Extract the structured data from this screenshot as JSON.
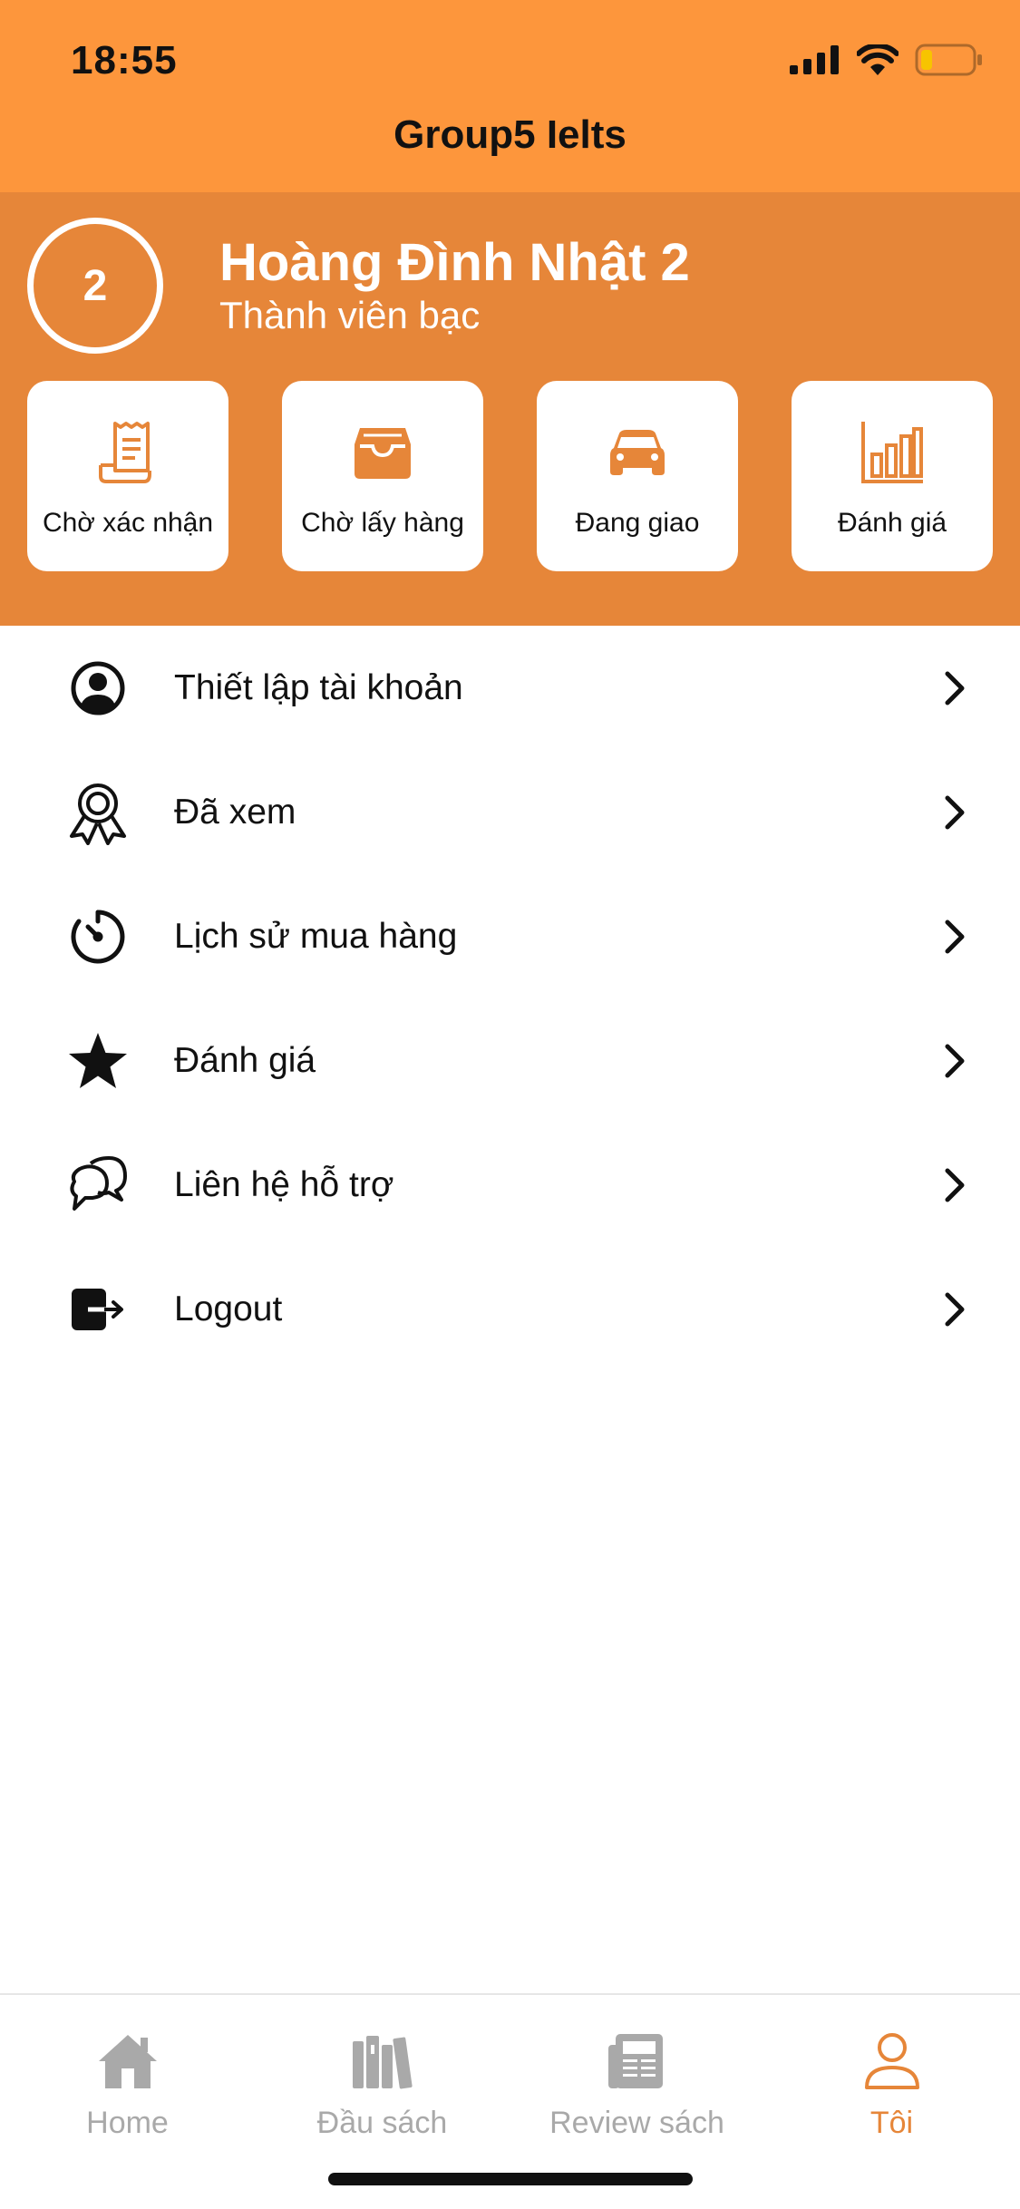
{
  "status_bar": {
    "time": "18:55"
  },
  "header": {
    "title": "Group5 Ielts"
  },
  "profile": {
    "avatar_text": "2",
    "name": "Hoàng Đình Nhật 2",
    "tier": "Thành viên bạc"
  },
  "order_cards": [
    {
      "label": "Chờ xác nhận",
      "icon": "receipt-icon"
    },
    {
      "label": "Chờ lấy hàng",
      "icon": "inbox-tray-icon"
    },
    {
      "label": "Đang giao",
      "icon": "car-icon"
    },
    {
      "label": "Đánh giá",
      "icon": "bar-chart-icon"
    }
  ],
  "menu": [
    {
      "label": "Thiết lập tài khoản",
      "icon": "user-circle-icon"
    },
    {
      "label": "Đã xem",
      "icon": "award-badge-icon"
    },
    {
      "label": "Lịch sử mua hàng",
      "icon": "timer-icon"
    },
    {
      "label": "Đánh giá",
      "icon": "star-icon"
    },
    {
      "label": "Liên hệ hỗ trợ",
      "icon": "chat-bubbles-icon"
    },
    {
      "label": "Logout",
      "icon": "logout-icon"
    }
  ],
  "tabs": [
    {
      "label": "Home",
      "icon": "home-icon",
      "active": false
    },
    {
      "label": "Đầu sách",
      "icon": "books-icon",
      "active": false
    },
    {
      "label": "Review sách",
      "icon": "newspaper-icon",
      "active": false
    },
    {
      "label": "Tôi",
      "icon": "person-icon",
      "active": true
    }
  ],
  "colors": {
    "header_bg": "#fd963c",
    "profile_bg": "#e68639",
    "accent": "#e68639",
    "tab_inactive": "#a9a9a9",
    "battery_level": "#f7c400"
  }
}
